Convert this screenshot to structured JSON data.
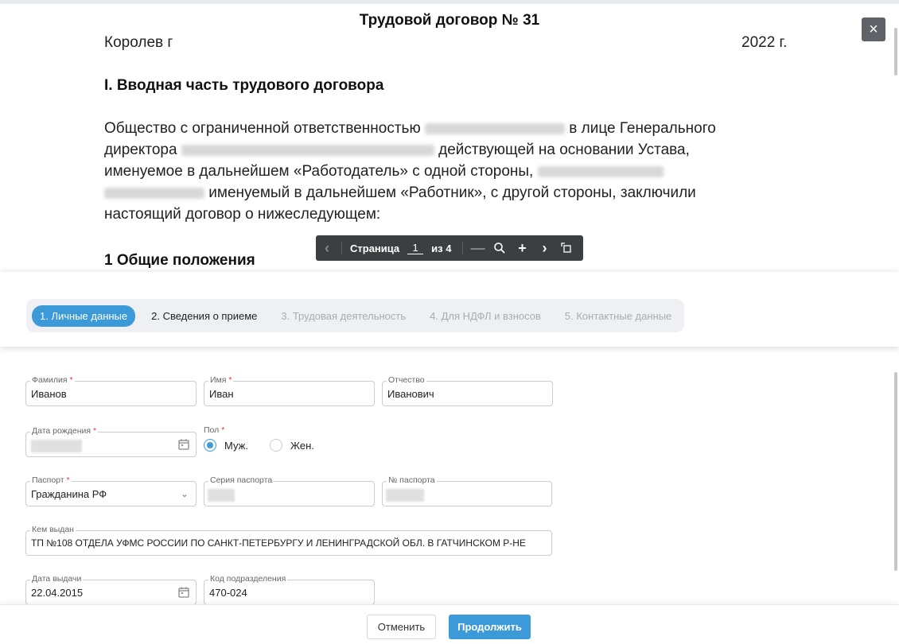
{
  "document": {
    "title": "Трудовой договор № 31",
    "city": "Королев г",
    "year": "2022 г.",
    "section": "I. Вводная часть трудового договора",
    "para_1": "Общество с ограниченной ответственностью",
    "para_2": "в лице Генерального",
    "para_3": "директора",
    "para_4": "действующей на основании Устава,",
    "para_5": "именуемое в дальнейшем «Работодатель» с одной стороны,",
    "para_6": "именуемый в дальнейшем «Работник», с другой стороны, заключили",
    "para_7": "настоящий договор о нижеследующем:",
    "heading_1": "1  Общие положения"
  },
  "pager": {
    "label": "Страница",
    "current": "1",
    "total": "из 4"
  },
  "steps": [
    {
      "label": "1. Личные данные",
      "state": "active"
    },
    {
      "label": "2. Сведения о приеме",
      "state": "current"
    },
    {
      "label": "3. Трудовая деятельность",
      "state": "disabled"
    },
    {
      "label": "4. Для НДФЛ и взносов",
      "state": "disabled"
    },
    {
      "label": "5. Контактные данные",
      "state": "disabled"
    }
  ],
  "form": {
    "last_name": {
      "label": "Фамилия",
      "value": "Иванов"
    },
    "first_name": {
      "label": "Имя",
      "value": "Иван"
    },
    "middle_name": {
      "label": "Отчество",
      "value": "Иванович"
    },
    "birth_date": {
      "label": "Дата рождения",
      "value": ""
    },
    "gender": {
      "label": "Пол",
      "male": "Муж.",
      "female": "Жен.",
      "selected": "male"
    },
    "passport": {
      "label": "Паспорт",
      "value": "Гражданина РФ"
    },
    "passport_series": {
      "label": "Серия паспорта",
      "value": ""
    },
    "passport_number": {
      "label": "№ паспорта",
      "value": ""
    },
    "issued_by": {
      "label": "Кем выдан",
      "value": "ТП №108 ОТДЕЛА УФМС РОССИИ ПО САНКТ-ПЕТЕРБУРГУ И ЛЕНИНГРАДСКОЙ ОБЛ. В ГАТЧИНСКОМ Р-НЕ"
    },
    "issue_date": {
      "label": "Дата выдачи",
      "value": "22.04.2015"
    },
    "division_code": {
      "label": "Код подразделения",
      "value": "470-024"
    }
  },
  "footer": {
    "cancel": "Отменить",
    "continue": "Продолжить"
  },
  "colors": {
    "accent": "#3d9ad8",
    "required": "#e53935",
    "toolbar": "#3c3f42"
  }
}
